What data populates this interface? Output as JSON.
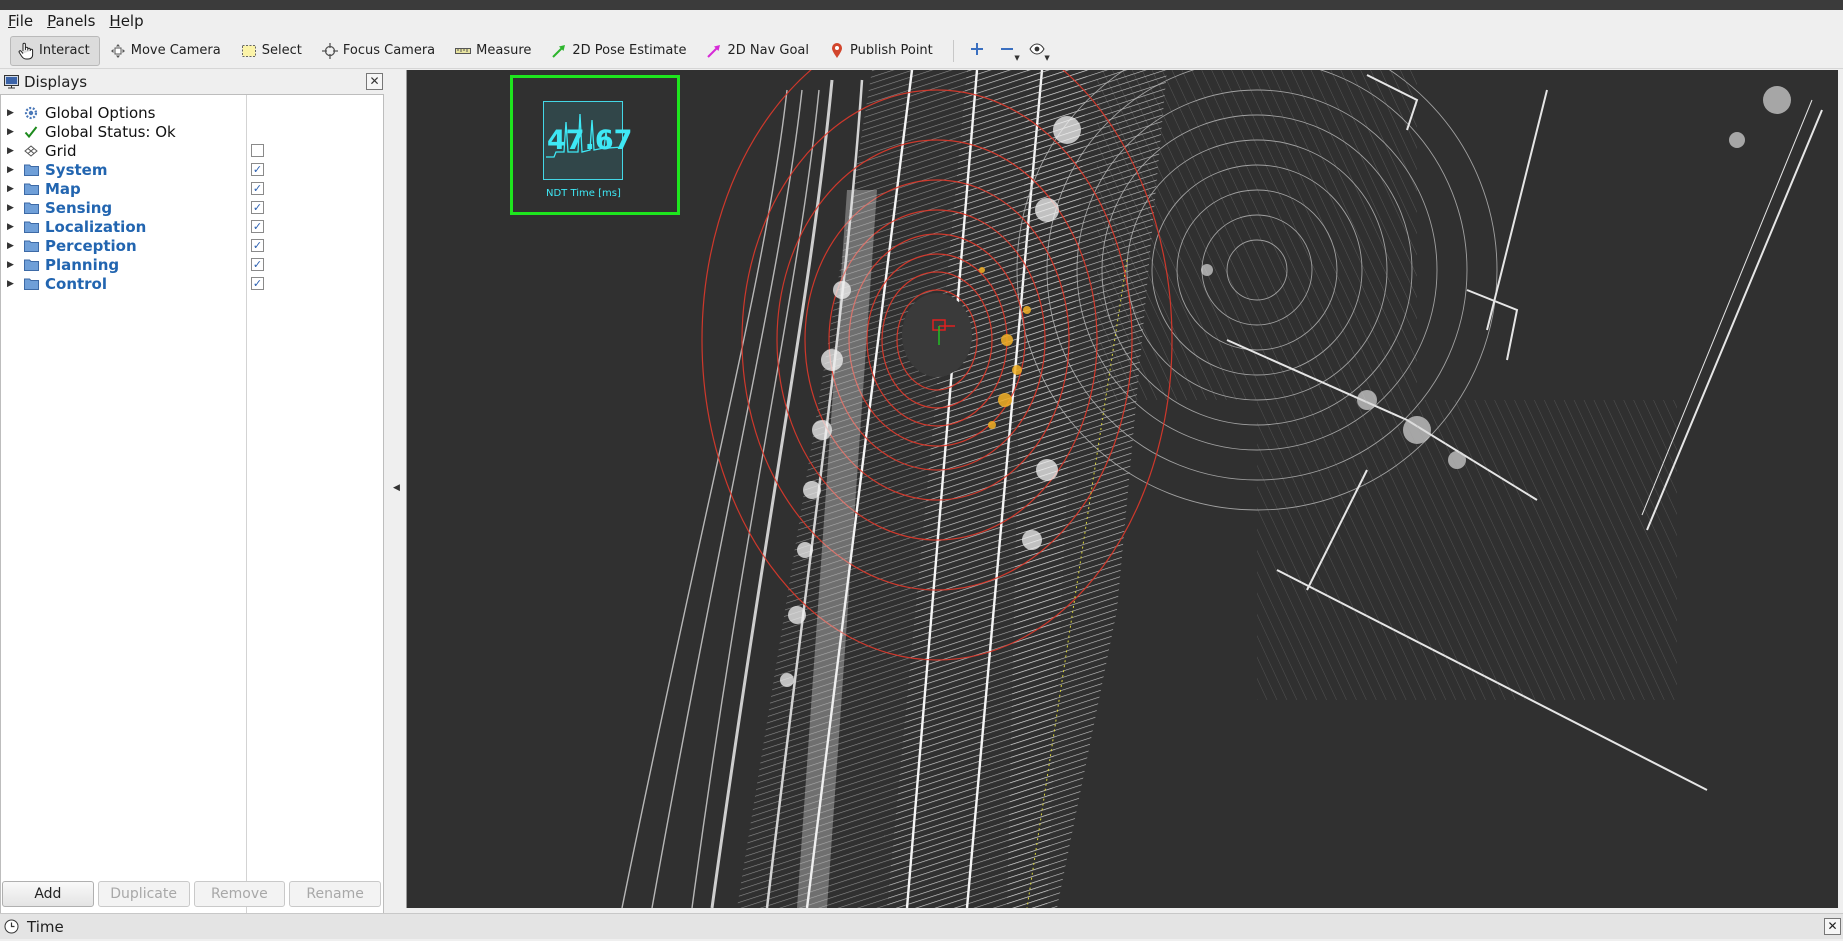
{
  "window": {
    "title": ""
  },
  "menubar": {
    "items": [
      "File",
      "Panels",
      "Help"
    ]
  },
  "toolbar": {
    "tools": [
      {
        "label": "Interact",
        "icon": "hand-pointer-icon",
        "active": true
      },
      {
        "label": "Move Camera",
        "icon": "move-camera-icon",
        "active": false
      },
      {
        "label": "Select",
        "icon": "select-box-icon",
        "active": false
      },
      {
        "label": "Focus Camera",
        "icon": "focus-camera-icon",
        "active": false
      },
      {
        "label": "Measure",
        "icon": "ruler-icon",
        "active": false
      },
      {
        "label": "2D Pose Estimate",
        "icon": "green-arrow-icon",
        "active": false
      },
      {
        "label": "2D Nav Goal",
        "icon": "magenta-arrow-icon",
        "active": false
      },
      {
        "label": "Publish Point",
        "icon": "map-pin-icon",
        "active": false
      }
    ],
    "extra_icons": [
      "plus-icon",
      "minus-icon",
      "eye-icon"
    ]
  },
  "displays": {
    "title": "Displays",
    "items": [
      {
        "label": "Global Options",
        "icon": "gear-icon",
        "style": "plain",
        "has_checkbox": false
      },
      {
        "label": "Global Status: Ok",
        "icon": "checkmark-icon",
        "style": "plain",
        "has_checkbox": false
      },
      {
        "label": "Grid",
        "icon": "grid-icon",
        "style": "plain",
        "has_checkbox": true,
        "checked": false
      },
      {
        "label": "System",
        "icon": "folder-icon",
        "style": "group",
        "has_checkbox": true,
        "checked": true
      },
      {
        "label": "Map",
        "icon": "folder-icon",
        "style": "group",
        "has_checkbox": true,
        "checked": true
      },
      {
        "label": "Sensing",
        "icon": "folder-icon",
        "style": "group",
        "has_checkbox": true,
        "checked": true
      },
      {
        "label": "Localization",
        "icon": "folder-icon",
        "style": "group",
        "has_checkbox": true,
        "checked": true
      },
      {
        "label": "Perception",
        "icon": "folder-icon",
        "style": "group",
        "has_checkbox": true,
        "checked": true
      },
      {
        "label": "Planning",
        "icon": "folder-icon",
        "style": "group",
        "has_checkbox": true,
        "checked": true
      },
      {
        "label": "Control",
        "icon": "folder-icon",
        "style": "group",
        "has_checkbox": true,
        "checked": true
      }
    ],
    "buttons": [
      {
        "label": "Add",
        "enabled": true
      },
      {
        "label": "Duplicate",
        "enabled": false
      },
      {
        "label": "Remove",
        "enabled": false
      },
      {
        "label": "Rename",
        "enabled": false
      }
    ]
  },
  "overlay": {
    "ndt_value": "47.67",
    "ndt_caption": "NDT Time [ms]",
    "accent_color": "#3ee8f5",
    "box_color": "#1ee51e"
  },
  "timebar": {
    "label": "Time"
  },
  "colors": {
    "viewport_bg": "#303030",
    "group_text": "#2265b0",
    "scan_red": "#e0392b"
  }
}
